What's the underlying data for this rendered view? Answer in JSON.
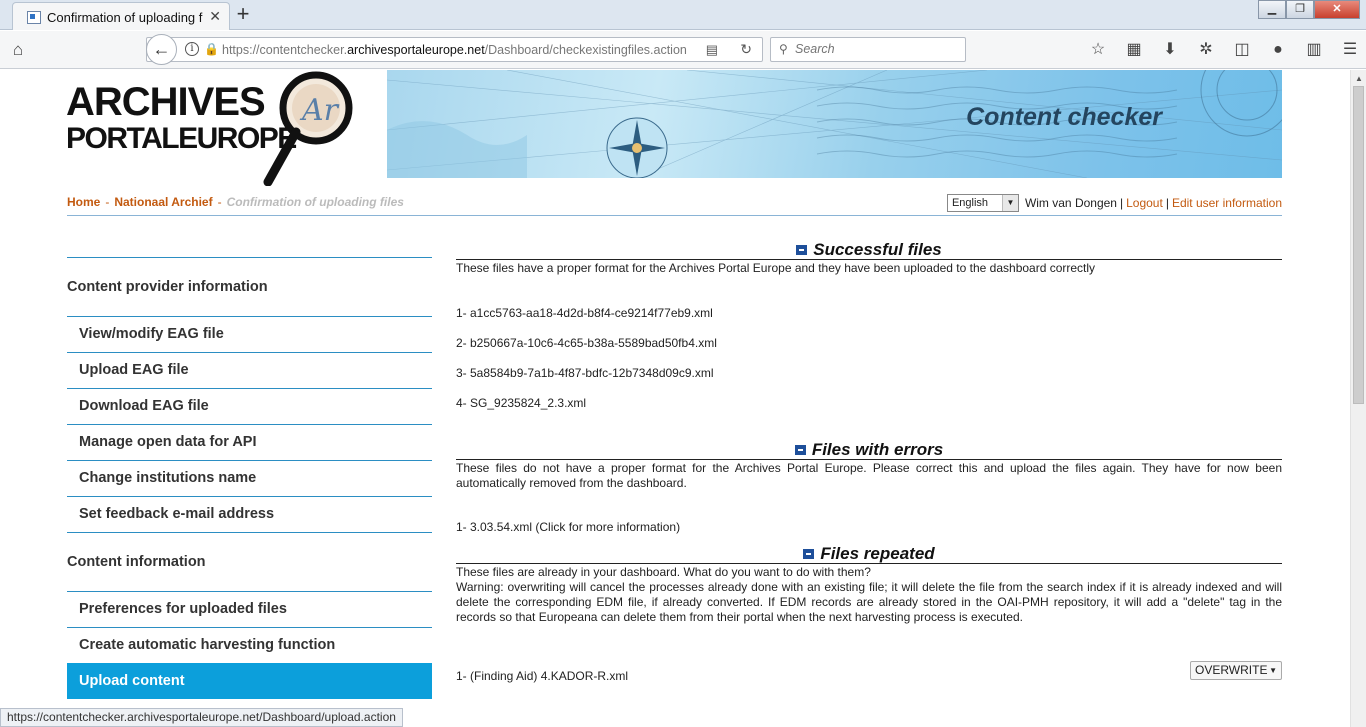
{
  "browser": {
    "tab_title": "Confirmation of uploading fi",
    "url_prefix": "https://contentchecker.",
    "url_domain": "archivesportaleurope.net",
    "url_path": "/Dashboard/checkexistingfiles.action",
    "search_placeholder": "Search",
    "status_url": "https://contentchecker.archivesportaleurope.net/Dashboard/upload.action"
  },
  "header": {
    "logo_line1": "ARCHIVES",
    "logo_line2": "PORTALEUROPE",
    "logo_mark": "Ar",
    "banner_title": "Content checker"
  },
  "breadcrumb": {
    "home": "Home",
    "institution": "Nationaal Archief",
    "current": "Confirmation of uploading files",
    "separator": "-"
  },
  "userbar": {
    "language": "English",
    "user_name": "Wim van Dongen",
    "logout": "Logout",
    "edit_user": "Edit user information"
  },
  "sidebar": {
    "section1": "Content provider information",
    "items1": [
      "View/modify EAG file",
      "Upload EAG file",
      "Download EAG file",
      "Manage open data for API",
      "Change institutions name",
      "Set feedback e-mail address"
    ],
    "section2": "Content information",
    "items2": [
      "Preferences for uploaded files",
      "Create automatic harvesting function",
      "Upload content"
    ]
  },
  "main": {
    "successful": {
      "title": "Successful files",
      "desc": "These files have a proper format for the Archives Portal Europe and they have been uploaded to the dashboard correctly",
      "files": [
        "1- a1cc5763-aa18-4d2d-b8f4-ce9214f77eb9.xml",
        "2- b250667a-10c6-4c65-b38a-5589bad50fb4.xml",
        "3- 5a8584b9-7a1b-4f87-bdfc-12b7348d09c9.xml",
        "4- SG_9235824_2.3.xml"
      ]
    },
    "errors": {
      "title": "Files with errors",
      "desc": "These files do not have a proper format for the Archives Portal Europe. Please correct this and upload the files again. They have for now been automatically removed from the dashboard.",
      "files": [
        "1- 3.03.54.xml (Click for more information)"
      ]
    },
    "repeated": {
      "title": "Files repeated",
      "desc1": "These files are already in your dashboard. What do you want to do with them?",
      "desc2": "Warning: overwriting will cancel the processes already done with an existing file; it will delete the file from the search index if it is already indexed and will delete the corresponding EDM file, if already converted. If EDM records are already stored in the OAI-PMH repository, it will add a \"delete\" tag in the records so that Europeana can delete them from their portal when the next harvesting process is executed.",
      "files": [
        "1- (Finding Aid) 4.KADOR-R.xml"
      ],
      "action": "OVERWRITE"
    }
  }
}
